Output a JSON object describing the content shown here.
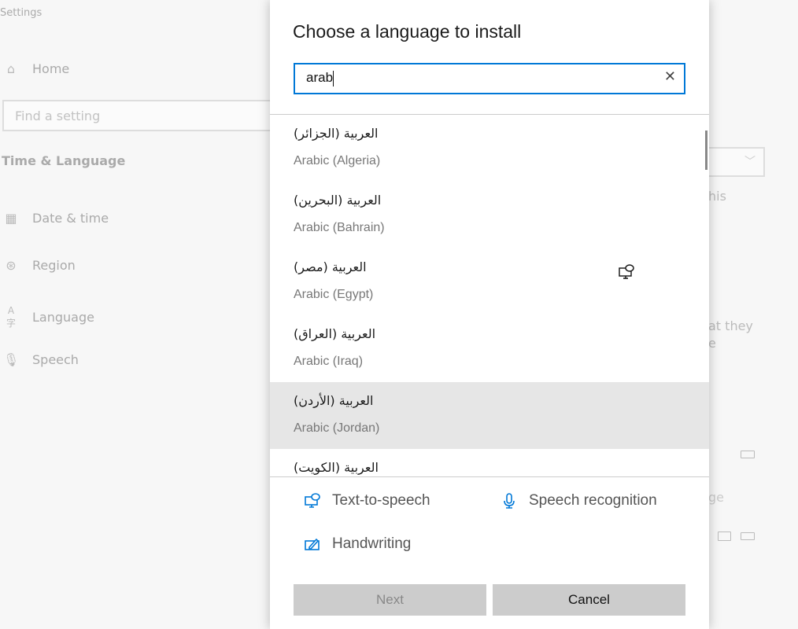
{
  "settings": {
    "app_title": "Settings",
    "home": "Home",
    "search_placeholder": "Find a setting",
    "section": "Time & Language",
    "nav": [
      {
        "label": "Date & time",
        "icon": "calendar-clock-icon"
      },
      {
        "label": "Region",
        "icon": "globe-icon"
      },
      {
        "label": "Language",
        "icon": "language-icon"
      },
      {
        "label": "Speech",
        "icon": "microphone-icon"
      }
    ],
    "right_fragments": [
      "his",
      "at they",
      "e",
      "ge"
    ]
  },
  "dialog": {
    "title": "Choose a language to install",
    "search_value": "arab",
    "languages": [
      {
        "native": "العربية (الجزائر)",
        "english": "Arabic (Algeria)"
      },
      {
        "native": "العربية (البحرين)",
        "english": "Arabic (Bahrain)"
      },
      {
        "native": "العربية (مصر)",
        "english": "Arabic (Egypt)"
      },
      {
        "native": "العربية (العراق)",
        "english": "Arabic (Iraq)"
      },
      {
        "native": "العربية (الأردن)",
        "english": "Arabic (Jordan)",
        "selected": true
      },
      {
        "native": "العربية (الكويت)",
        "english": ""
      }
    ],
    "features": {
      "tts": "Text-to-speech",
      "speech": "Speech recognition",
      "handwriting": "Handwriting"
    },
    "next": "Next",
    "cancel": "Cancel",
    "accent": "#0078d7"
  }
}
